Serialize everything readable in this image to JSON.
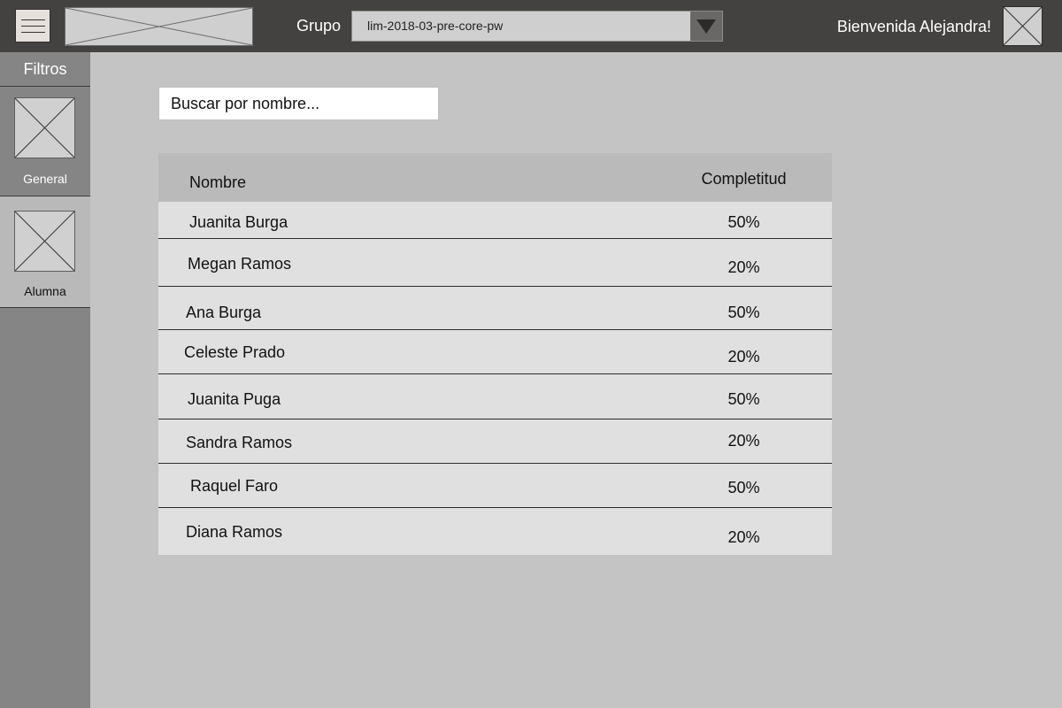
{
  "header": {
    "group_label": "Grupo",
    "group_selected": "lim-2018-03-pre-core-pw",
    "welcome": "Bienvenida Alejandra!",
    "menu_icon": "hamburger-icon",
    "logo_icon": "image-placeholder-icon",
    "avatar_icon": "image-placeholder-icon"
  },
  "sidebar": {
    "title": "Filtros",
    "items": [
      {
        "label": "General",
        "icon": "image-placeholder-icon",
        "active": false
      },
      {
        "label": "Alumna",
        "icon": "image-placeholder-icon",
        "active": true
      }
    ]
  },
  "search": {
    "placeholder": "Buscar por nombre..."
  },
  "table": {
    "columns": [
      "Nombre",
      "Completitud"
    ],
    "rows": [
      {
        "name": "Juanita Burga",
        "completion": "50%"
      },
      {
        "name": "Megan Ramos",
        "completion": "20%"
      },
      {
        "name": "Ana Burga",
        "completion": "50%"
      },
      {
        "name": "Celeste Prado",
        "completion": "20%"
      },
      {
        "name": "Juanita Puga",
        "completion": "50%"
      },
      {
        "name": "Sandra Ramos",
        "completion": "20%"
      },
      {
        "name": "Raquel Faro",
        "completion": "50%"
      },
      {
        "name": "Diana Ramos",
        "completion": "20%"
      }
    ]
  },
  "colors": {
    "topbar": "#444240",
    "sidebar": "#858585",
    "content_bg": "#c4c4c4",
    "table_header": "#bababa",
    "table_row": "#e0e0e0"
  }
}
